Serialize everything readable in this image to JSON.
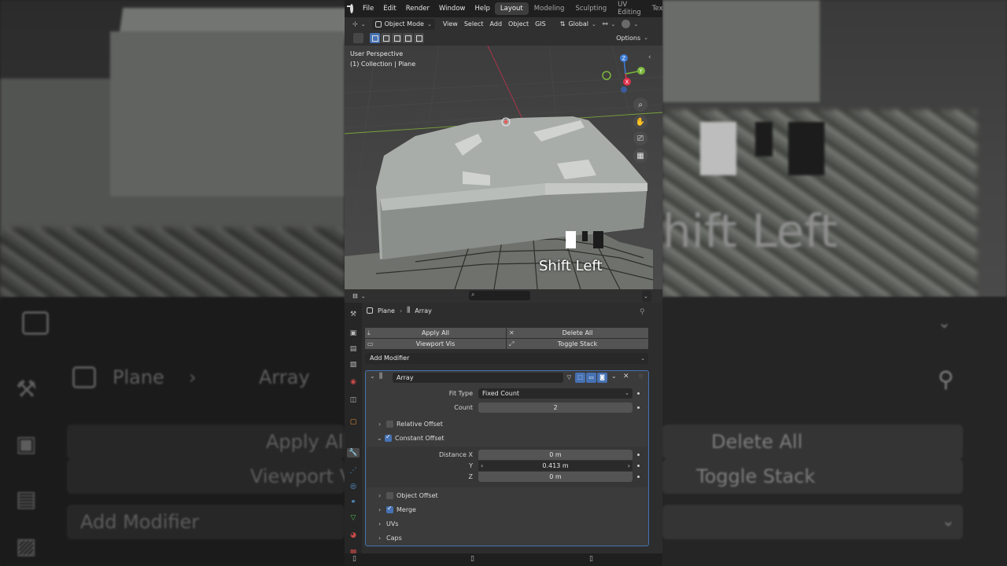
{
  "background_overlay": {
    "breadcrumb_object": "Plane",
    "breadcrumb_modifier": "Array",
    "apply_all": "Apply All",
    "viewport_vis": "Viewport V",
    "delete_all": "Delete All",
    "toggle_stack": "Toggle Stack",
    "add_modifier": "Add Modifier",
    "shift_left": "hift Left"
  },
  "topbar": {
    "menus": [
      "File",
      "Edit",
      "Render",
      "Window",
      "Help"
    ],
    "workspaces": [
      "Layout",
      "Modeling",
      "Sculpting",
      "UV Editing",
      "Textu"
    ],
    "active_workspace": "Layout"
  },
  "header": {
    "mode": "Object Mode",
    "menus": [
      "View",
      "Select",
      "Add",
      "Object",
      "GIS"
    ],
    "orientation": "Global",
    "options": "Options"
  },
  "viewport": {
    "view_name": "User Perspective",
    "collection": "(1) Collection | Plane",
    "key_hint": "Shift Left",
    "gizmo_axes": [
      "Z",
      "Y",
      "X"
    ]
  },
  "properties": {
    "breadcrumb_object": "Plane",
    "breadcrumb_modifier": "Array",
    "apply_all": "Apply All",
    "delete_all": "Delete All",
    "viewport_vis": "Viewport Vis",
    "toggle_stack": "Toggle Stack",
    "add_modifier": "Add Modifier",
    "modifier": {
      "name": "Array",
      "fit_type_label": "Fit Type",
      "fit_type_value": "Fixed Count",
      "count_label": "Count",
      "count_value": "2",
      "relative_offset": "Relative Offset",
      "constant_offset": "Constant Offset",
      "distance_x_label": "Distance X",
      "distance_x_value": "0 m",
      "y_label": "Y",
      "y_value": "0.413 m",
      "z_label": "Z",
      "z_value": "0 m",
      "object_offset": "Object Offset",
      "merge": "Merge",
      "uvs": "UVs",
      "caps": "Caps",
      "relative_offset_checked": false,
      "constant_offset_checked": true,
      "object_offset_checked": false,
      "merge_checked": true
    }
  },
  "colors": {
    "accent": "#4772b3",
    "x_axis": "#e0304a",
    "y_axis": "#7cb83d",
    "z_axis": "#3a7ad6"
  }
}
